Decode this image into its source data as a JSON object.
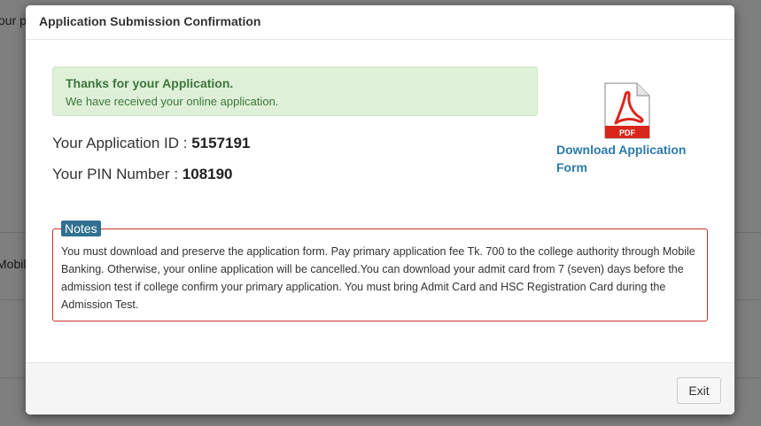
{
  "background": {
    "text_top": "our p",
    "text_mid": "Mobile"
  },
  "modal": {
    "title": "Application Submission Confirmation",
    "alert": {
      "title": "Thanks for your Application.",
      "message": "We have received your online application."
    },
    "application_id": {
      "label": "Your Application ID : ",
      "value": "5157191"
    },
    "pin_number": {
      "label": "Your PIN Number : ",
      "value": "108190"
    },
    "download": {
      "icon": "pdf-file-icon",
      "icon_text": "PDF",
      "label": "Download Application Form"
    },
    "notes": {
      "label": "Notes",
      "text": "You must download and preserve the application form. Pay primary application fee Tk. 700 to the college authority through Mobile Banking. Otherwise, your online application will be cancelled.You can download your admit card from 7 (seven) days before the admission test if college confirm your primary application. You must bring Admit Card and HSC Registration Card during the Admission Test."
    },
    "footer": {
      "exit_label": "Exit"
    }
  },
  "colors": {
    "alert_bg": "#dff0d8",
    "alert_text": "#3c763d",
    "link": "#2a7aaa",
    "notes_border": "#c9302c",
    "notes_label_bg": "#31708f",
    "pdf_red": "#d9261c"
  }
}
